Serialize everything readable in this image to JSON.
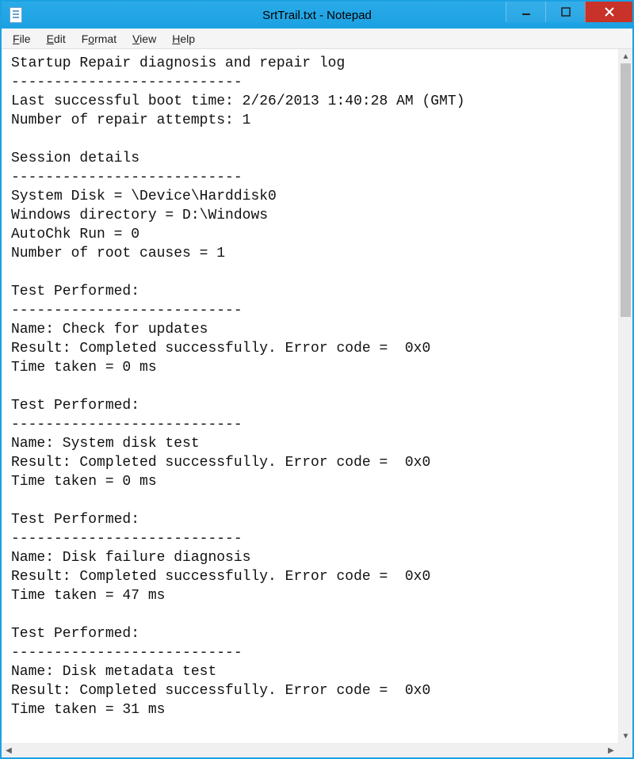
{
  "window": {
    "title": "SrtTrail.txt - Notepad"
  },
  "menu": {
    "file": "File",
    "edit": "Edit",
    "format": "Format",
    "view": "View",
    "help": "Help"
  },
  "content": "Startup Repair diagnosis and repair log\n---------------------------\nLast successful boot time: 2/26/2013 1:40:28 AM (GMT)\nNumber of repair attempts: 1\n\nSession details\n---------------------------\nSystem Disk = \\Device\\Harddisk0\nWindows directory = D:\\Windows\nAutoChk Run = 0\nNumber of root causes = 1\n\nTest Performed: \n---------------------------\nName: Check for updates\nResult: Completed successfully. Error code =  0x0\nTime taken = 0 ms\n\nTest Performed: \n---------------------------\nName: System disk test\nResult: Completed successfully. Error code =  0x0\nTime taken = 0 ms\n\nTest Performed: \n---------------------------\nName: Disk failure diagnosis\nResult: Completed successfully. Error code =  0x0\nTime taken = 47 ms\n\nTest Performed: \n---------------------------\nName: Disk metadata test\nResult: Completed successfully. Error code =  0x0\nTime taken = 31 ms\n"
}
